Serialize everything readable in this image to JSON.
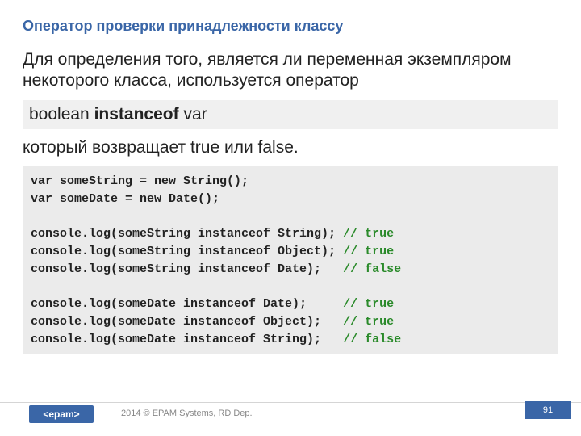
{
  "title": "Оператор проверки принадлежности классу",
  "intro": "Для определения того, является ли переменная экземпляром некоторого класса, используется оператор",
  "syntax": {
    "pre": "boolean ",
    "keyword": "instanceof",
    "post": " var"
  },
  "result_sentence": "который возвращает true или false.",
  "code": {
    "l1": "var someString = new String();",
    "l2": "var someDate = new Date();",
    "blank1": "",
    "l3a": "console.log(someString instanceof String); ",
    "l3c": "// true",
    "l4a": "console.log(someString instanceof Object); ",
    "l4c": "// true",
    "l5a": "console.log(someString instanceof Date);   ",
    "l5c": "// false",
    "blank2": "",
    "l6a": "console.log(someDate instanceof Date);     ",
    "l6c": "// true",
    "l7a": "console.log(someDate instanceof Object);   ",
    "l7c": "// true",
    "l8a": "console.log(someDate instanceof String);   ",
    "l8c": "// false"
  },
  "footer": {
    "logo": "<epam>",
    "copyright": "2014 © EPAM Systems, RD Dep.",
    "page_number": "91"
  }
}
